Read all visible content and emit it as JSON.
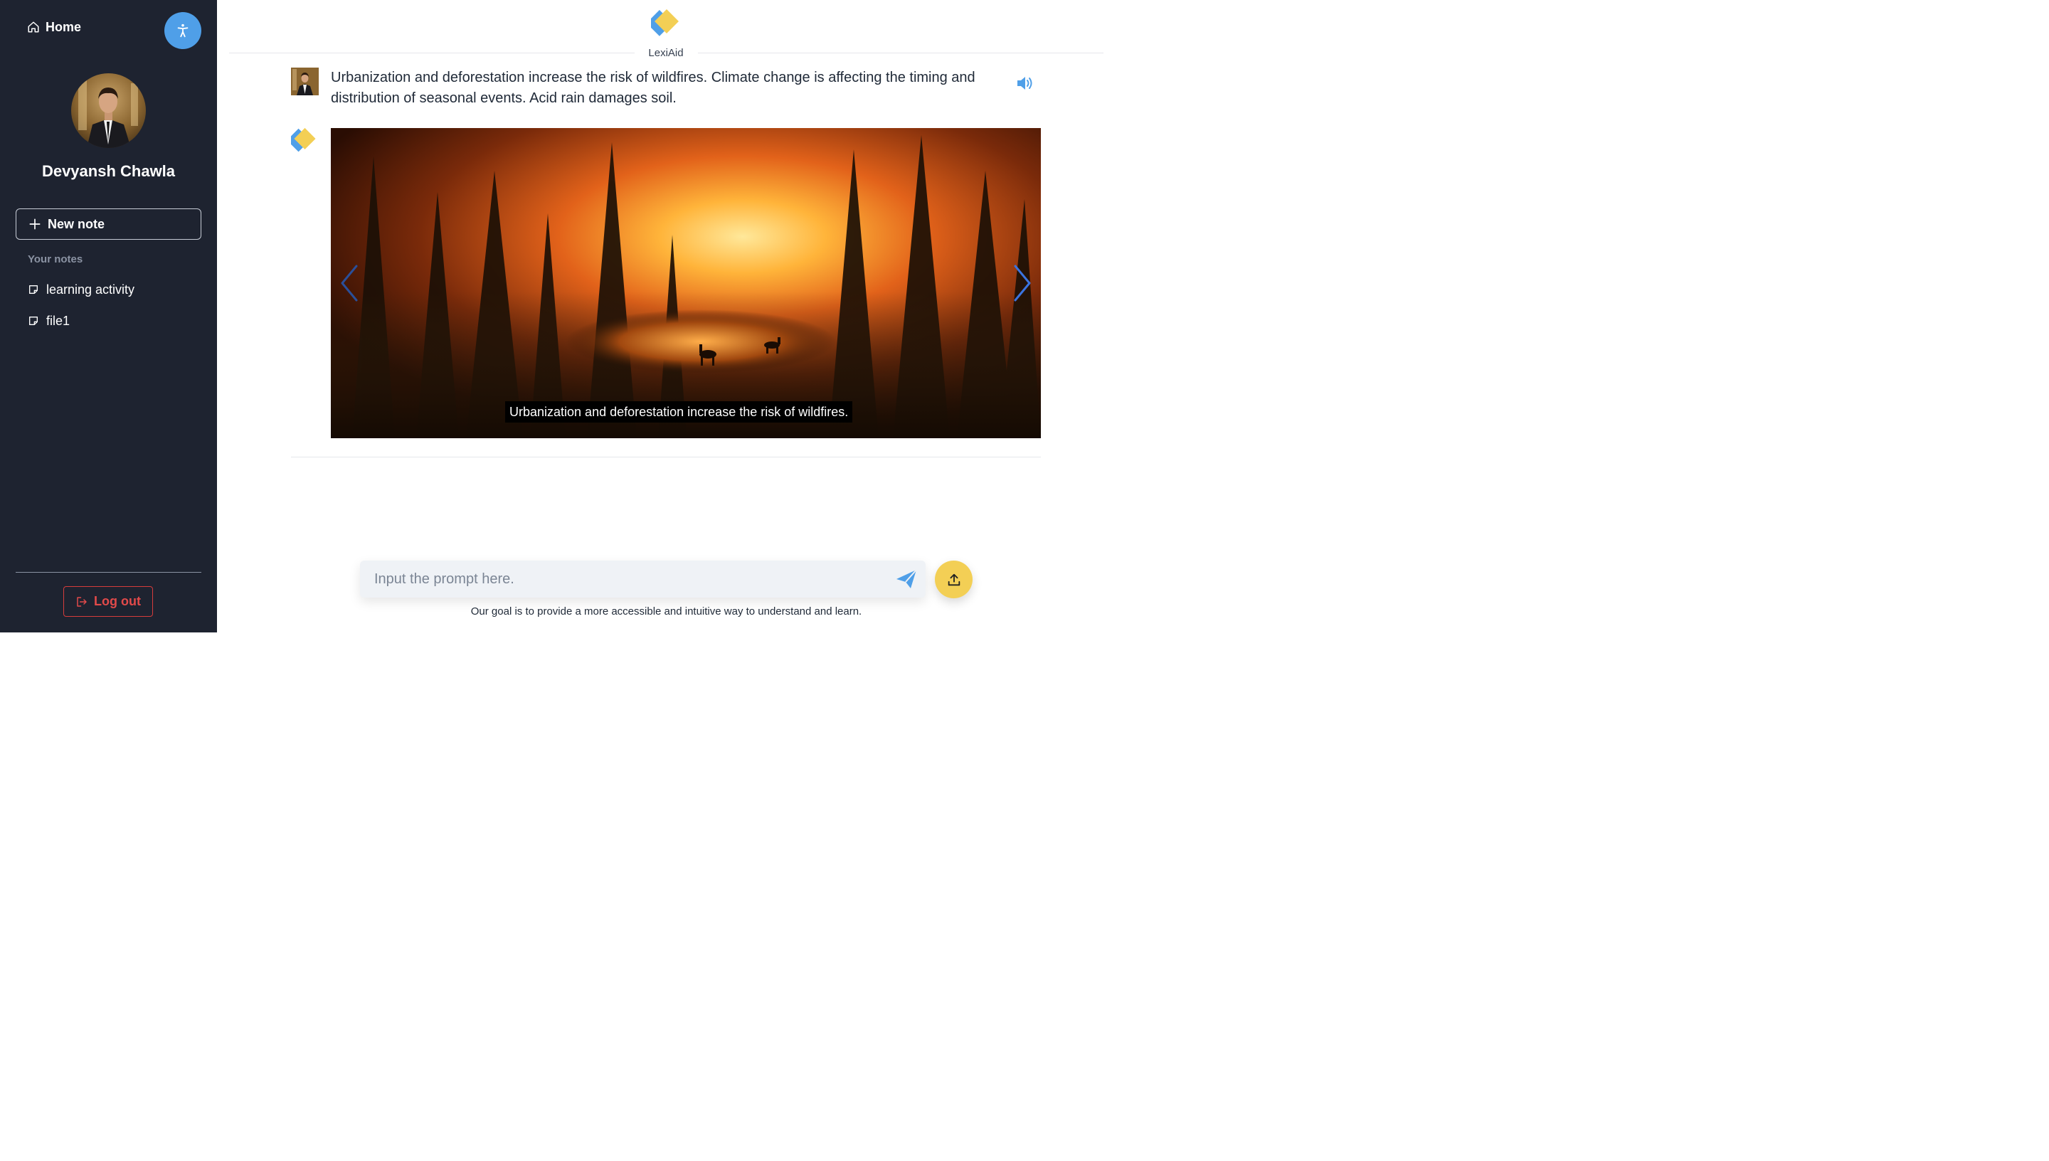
{
  "sidebar": {
    "home_label": "Home",
    "accessibility_icon": "accessibility-person-icon",
    "user_name": "Devyansh Chawla",
    "new_note_label": "New note",
    "notes_heading": "Your notes",
    "notes": [
      {
        "label": "learning activity",
        "icon": "note-icon"
      },
      {
        "label": "file1",
        "icon": "note-icon"
      }
    ],
    "logout_label": "Log out",
    "accessibility_button_color": "#4f9fe8",
    "logout_color": "#e24a4a",
    "background_color": "#1e2330"
  },
  "header": {
    "brand": "LexiAid",
    "logo_colors": [
      "#4f9fe8",
      "#f3cf55"
    ]
  },
  "chat": {
    "user_message": "Urbanization and deforestation increase the risk of wildfires. Climate change is affecting the timing and distribution of seasonal events. Acid rain damages soil.",
    "speaker_icon": "speaker-volume-icon",
    "carousel": {
      "caption": "Urbanization and deforestation increase the risk of wildfires.",
      "image_description_icon": "forest-wildfire-image",
      "prev_icon": "chevron-left-icon",
      "next_icon": "chevron-right-icon"
    }
  },
  "prompt": {
    "placeholder": "Input the prompt here.",
    "value": "",
    "send_icon": "send-paper-plane-icon",
    "upload_icon": "upload-icon",
    "upload_color": "#f3cf55"
  },
  "footer": {
    "text": "Our goal is to provide a more accessible and intuitive way to understand and learn."
  }
}
